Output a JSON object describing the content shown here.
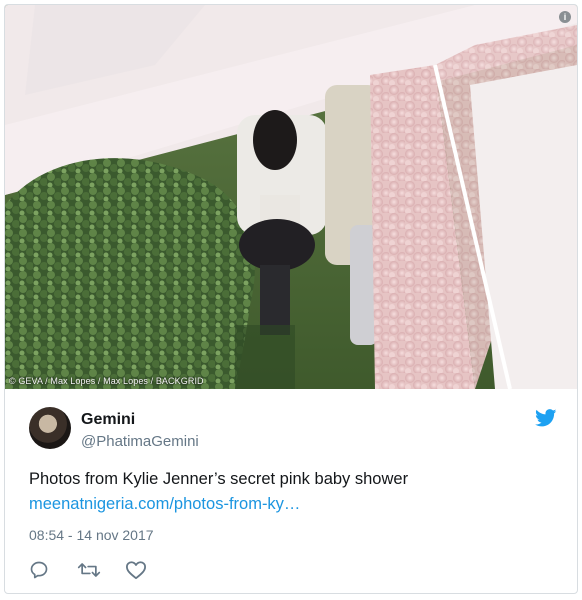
{
  "photo": {
    "credit": "© GEVA / Max Lopes / Max Lopes / BACKGRID",
    "info_icon": "info-icon"
  },
  "author": {
    "name": "Gemini",
    "handle": "@PhatimaGemini",
    "avatar": "avatar-photo"
  },
  "tweet": {
    "text": "Photos from Kylie Jenner’s secret pink baby shower",
    "link": "meenatnigeria.com/photos-from-ky…",
    "timestamp": "08:54 - 14 nov 2017"
  },
  "actions": [
    "reply-icon",
    "retweet-icon",
    "like-icon"
  ],
  "colors": {
    "link": "#1b95e0",
    "secondary": "#657786",
    "text": "#14171a",
    "brand": "#1da1f2"
  }
}
